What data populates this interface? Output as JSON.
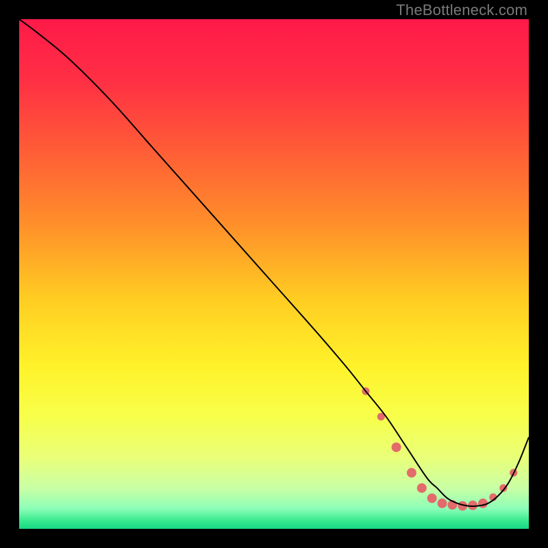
{
  "watermark": "TheBottleneck.com",
  "gradient": {
    "stops": [
      {
        "offset": 0.0,
        "color": "#ff1a49"
      },
      {
        "offset": 0.12,
        "color": "#ff2f44"
      },
      {
        "offset": 0.25,
        "color": "#ff5a37"
      },
      {
        "offset": 0.4,
        "color": "#ff8e2a"
      },
      {
        "offset": 0.55,
        "color": "#ffcd22"
      },
      {
        "offset": 0.68,
        "color": "#fff22a"
      },
      {
        "offset": 0.78,
        "color": "#f7ff4a"
      },
      {
        "offset": 0.86,
        "color": "#e9ff78"
      },
      {
        "offset": 0.92,
        "color": "#c9ffa5"
      },
      {
        "offset": 0.96,
        "color": "#8dffb8"
      },
      {
        "offset": 0.985,
        "color": "#36e98e"
      },
      {
        "offset": 1.0,
        "color": "#17d884"
      }
    ]
  },
  "chart_data": {
    "type": "line",
    "title": "",
    "xlabel": "",
    "ylabel": "",
    "xlim": [
      0,
      100
    ],
    "ylim": [
      0,
      100
    ],
    "grid": false,
    "legend": false,
    "series": [
      {
        "name": "bottleneck-curve",
        "x": [
          0,
          4,
          10,
          18,
          26,
          34,
          42,
          50,
          58,
          64,
          68,
          72,
          76,
          80,
          82,
          84,
          86,
          88,
          90,
          92,
          94,
          96,
          98,
          100
        ],
        "y": [
          100,
          97,
          92,
          84,
          75,
          66,
          57,
          48,
          39,
          32,
          27,
          22,
          16,
          10,
          8,
          6,
          5,
          4.5,
          4.5,
          5,
          6.5,
          9,
          13,
          18
        ]
      }
    ],
    "markers": {
      "name": "valley-dots",
      "color": "#e36b6b",
      "points": [
        {
          "x": 68,
          "y": 27,
          "r": 4
        },
        {
          "x": 71,
          "y": 22,
          "r": 4
        },
        {
          "x": 74,
          "y": 16,
          "r": 5
        },
        {
          "x": 77,
          "y": 11,
          "r": 5
        },
        {
          "x": 79,
          "y": 8,
          "r": 5
        },
        {
          "x": 81,
          "y": 6,
          "r": 5
        },
        {
          "x": 83,
          "y": 5,
          "r": 5
        },
        {
          "x": 85,
          "y": 4.7,
          "r": 5
        },
        {
          "x": 87,
          "y": 4.5,
          "r": 5
        },
        {
          "x": 89,
          "y": 4.6,
          "r": 5
        },
        {
          "x": 91,
          "y": 5,
          "r": 5
        },
        {
          "x": 93,
          "y": 6.2,
          "r": 4
        },
        {
          "x": 95,
          "y": 8,
          "r": 4
        },
        {
          "x": 97,
          "y": 11,
          "r": 4
        }
      ]
    }
  }
}
